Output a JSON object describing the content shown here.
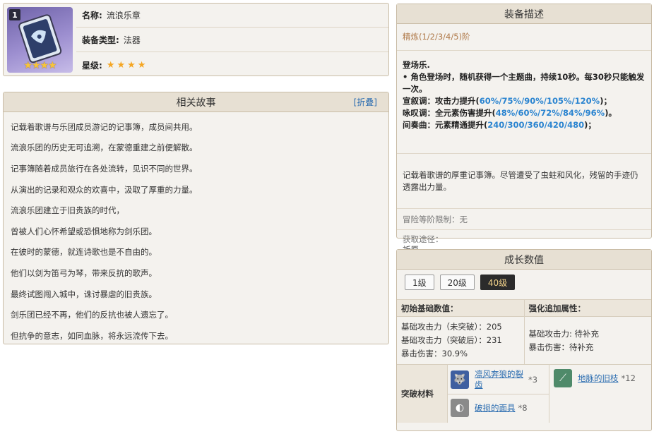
{
  "item": {
    "rank": "1",
    "name_label": "名称:",
    "name": "流浪乐章",
    "type_label": "装备类型:",
    "type": "法器",
    "rarity_label": "星级:",
    "rarity_stars": "★★★★",
    "thumb_stars": "★★★★"
  },
  "story": {
    "title": "相关故事",
    "fold": "[折叠]",
    "lines": [
      "记载着歌谱与乐团成员游记的记事簿，成员间共用。",
      "流浪乐团的历史无可追溯，在蒙德重建之前便解散。",
      "记事簿随着成员旅行在各处流转，见识不同的世界。",
      "从演出的记录和观众的欢喜中，汲取了厚重的力量。",
      "流浪乐团建立于旧贵族的时代，",
      "曾被人们心怀希望或恐惧地称为剑乐团。",
      "在彼时的蒙德，就连诗歌也是不自由的。",
      "他们以剑为笛弓为琴，带来反抗的歌声。",
      "最终试图闯入城中，诛讨暴虐的旧贵族。",
      "剑乐团已经不再，他们的反抗也被人遗忘了。",
      "但抗争的意志，如同血脉，将永远流传下去。"
    ]
  },
  "desc": {
    "title": "装备描述",
    "refine": "精炼(1/2/3/4/5)阶",
    "skill_name": "登场乐.",
    "skill_intro": "• 角色登场时，随机获得一个主题曲，持续10秒。每30秒只能触发一次。",
    "e1_label": "宣叙调：攻击力提升(",
    "e1_val": "60%/75%/90%/105%/120%",
    "e1_end": ")；",
    "e2_label": "咏叹调：全元素伤害提升(",
    "e2_val": "48%/60%/72%/84%/96%",
    "e2_end": ")。",
    "e3_label": "间奏曲：元素精通提升(",
    "e3_val": "240/300/360/420/480",
    "e3_end": ")；",
    "flavor": "记载着歌谱的厚重记事簿。尽管遭受了虫蛀和风化，残留的手迹仍透露出力量。",
    "level_limit": "冒险等阶限制：无",
    "obtain_label": "获取途径：",
    "obtain_value": "祈愿"
  },
  "growth": {
    "title": "成长数值",
    "levels": [
      "1级",
      "20级",
      "40级"
    ],
    "active_level": "40级",
    "base_head": "初始基础数值：",
    "bonus_head": "强化追加属性：",
    "base_lines": [
      "基础攻击力（未突破）：205",
      "基础攻击力（突破后）：231",
      "暴击伤害：30.9%"
    ],
    "bonus_lines": [
      "基础攻击力: 待补充",
      "暴击伤害：待补充"
    ],
    "mats_label": "突破材料",
    "mats": [
      {
        "name": "凛风奔狼的裂齿",
        "count": "*3",
        "icon": "wolf-tooth-icon",
        "color": "#3f5fa0"
      },
      {
        "name": "地脉的旧枝",
        "count": "*12",
        "icon": "ley-branch-icon",
        "color": "#4f8a6a"
      },
      {
        "name": "破损的面具",
        "count": "*8",
        "icon": "broken-mask-icon",
        "color": "#8a8a8a"
      }
    ]
  }
}
